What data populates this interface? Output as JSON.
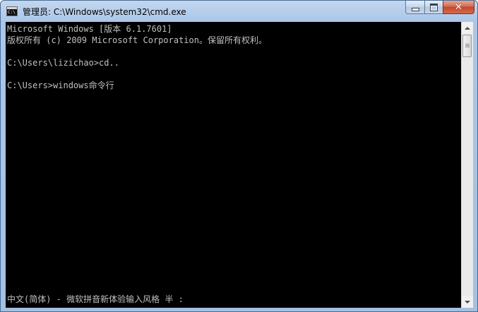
{
  "window": {
    "title": "管理员: C:\\Windows\\system32\\cmd.exe",
    "icon": "cmd-icon",
    "icon_text": "C:\\",
    "controls": {
      "minimize": "minimize-icon",
      "maximize": "maximize-icon",
      "close": "close-icon",
      "close_glyph": "✕"
    }
  },
  "console": {
    "background": "#000000",
    "text_color": "#c0c0c0",
    "lines": [
      "Microsoft Windows [版本 6.1.7601]",
      "版权所有 (c) 2009 Microsoft Corporation。保留所有权利。",
      "",
      "C:\\Users\\lizichao>cd..",
      "",
      "C:\\Users>windows命令行"
    ],
    "ime_status": "中文(简体) - 微软拼音新体验输入风格 半 :"
  },
  "colors": {
    "title_bar": "#aac6e8",
    "close_button": "#c4472c"
  }
}
